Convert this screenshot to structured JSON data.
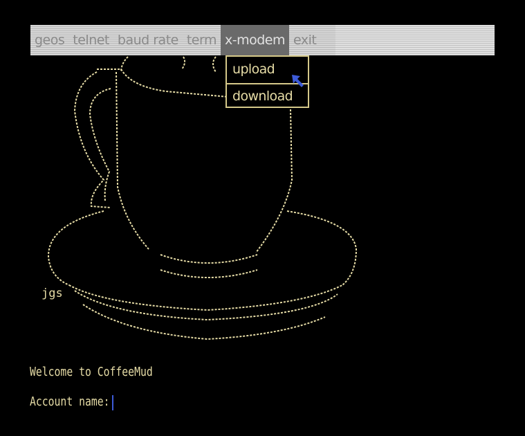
{
  "menubar": {
    "items": [
      {
        "label": "geos"
      },
      {
        "label": "telnet"
      },
      {
        "label": "baud rate"
      },
      {
        "label": "term"
      },
      {
        "label": "x-modem"
      },
      {
        "label": "exit"
      }
    ],
    "active_index": 4
  },
  "dropdown": {
    "items": [
      {
        "label": "upload"
      },
      {
        "label": "download"
      }
    ]
  },
  "art": {
    "signature": "jgs"
  },
  "terminal": {
    "welcome": "Welcome to CoffeeMud",
    "prompt": "Account name:"
  },
  "colors": {
    "background": "#000000",
    "text": "#e6dca6",
    "menubar": "#d6d6d6",
    "menu_active": "#6a6a6a",
    "cursor": "#3d5bd8"
  }
}
